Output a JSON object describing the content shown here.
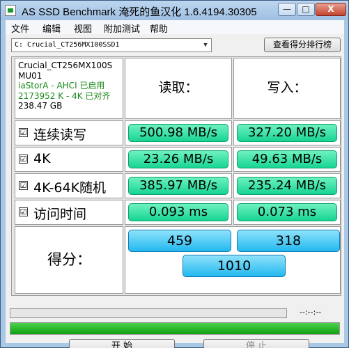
{
  "window": {
    "title": "AS SSD Benchmark 淹死的鱼汉化 1.6.4194.30305",
    "min_label": "—",
    "max_label": "□",
    "close_label": "X"
  },
  "menu": [
    "文件",
    "编辑",
    "视图",
    "附加测试",
    "帮助"
  ],
  "drive": {
    "selected": "C: Crucial_CT256MX100SSD1",
    "compare_label": "查看得分排行榜"
  },
  "info": {
    "model": "Crucial_CT256MX100S",
    "firmware": "MU01",
    "driver": "iaStorA - AHCI 已启用",
    "alignment": "2173952 K - 4K 已对齐",
    "capacity": "238.47 GB"
  },
  "headers": {
    "read": "读取：",
    "write": "写入："
  },
  "rows": [
    {
      "label": "连续读写",
      "checked": "☑",
      "read": "500.98 MB/s",
      "write": "327.20 MB/s"
    },
    {
      "label": "4K",
      "checked": "☑",
      "read": "23.26 MB/s",
      "write": "49.63 MB/s"
    },
    {
      "label": "4K-64K随机",
      "checked": "☑",
      "read": "385.97 MB/s",
      "write": "235.24 MB/s"
    },
    {
      "label": "访问时间",
      "checked": "☑",
      "read": "0.093 ms",
      "write": "0.073 ms"
    }
  ],
  "score": {
    "label": "得分：",
    "read": "459",
    "write": "318",
    "total": "1010"
  },
  "progress": {
    "time": "--:--:--",
    "fraction": 1.0
  },
  "buttons": {
    "start": "开 始",
    "stop": "停 止"
  }
}
